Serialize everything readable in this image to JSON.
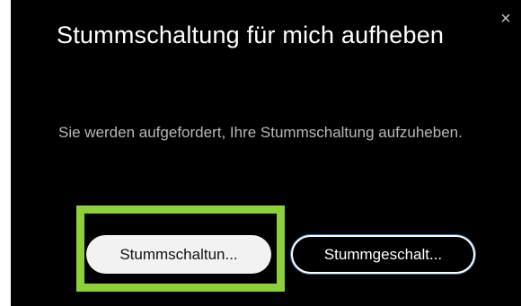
{
  "dialog": {
    "title": "Stummschaltung für mich aufheben",
    "close_glyph": "×",
    "message": "Sie werden aufgefordert, Ihre Stummschaltung aufzuheben.",
    "primary_button_label": "Stummschaltun...",
    "secondary_button_label": "Stummgeschalt...",
    "highlight_color": "#8dd13a",
    "background_color": "#000000"
  }
}
